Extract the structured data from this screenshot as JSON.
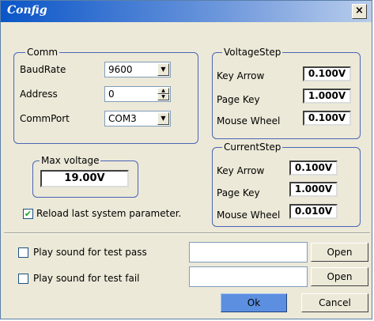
{
  "window": {
    "title": "Config",
    "close_label": "×"
  },
  "comm": {
    "legend": "Comm",
    "baudrate_label": "BaudRate",
    "baudrate_value": "9600",
    "address_label": "Address",
    "address_value": "0",
    "commport_label": "CommPort",
    "commport_value": "COM3"
  },
  "voltage_step": {
    "legend": "VoltageStep",
    "rows": [
      {
        "label": "Key Arrow",
        "value": "0.100V"
      },
      {
        "label": "Page Key",
        "value": "1.000V"
      },
      {
        "label": "Mouse Wheel",
        "value": "0.100V"
      }
    ]
  },
  "current_step": {
    "legend": "CurrentStep",
    "rows": [
      {
        "label": "Key Arrow",
        "value": "0.100V"
      },
      {
        "label": "Page Key",
        "value": "1.000V"
      },
      {
        "label": "Mouse Wheel",
        "value": "0.010V"
      }
    ]
  },
  "max_voltage": {
    "legend": "Max voltage",
    "value": "19.00V"
  },
  "reload": {
    "label": "Reload last system parameter.",
    "checked": true,
    "check_glyph": "✔"
  },
  "sound": {
    "pass_label": "Play sound for test pass",
    "pass_path": "",
    "fail_label": "Play sound for test fail",
    "fail_path": "",
    "open_label": "Open"
  },
  "buttons": {
    "ok": "Ok",
    "cancel": "Cancel"
  },
  "icons": {
    "dropdown": "▼",
    "spin_up": "▲",
    "spin_down": "▼"
  }
}
